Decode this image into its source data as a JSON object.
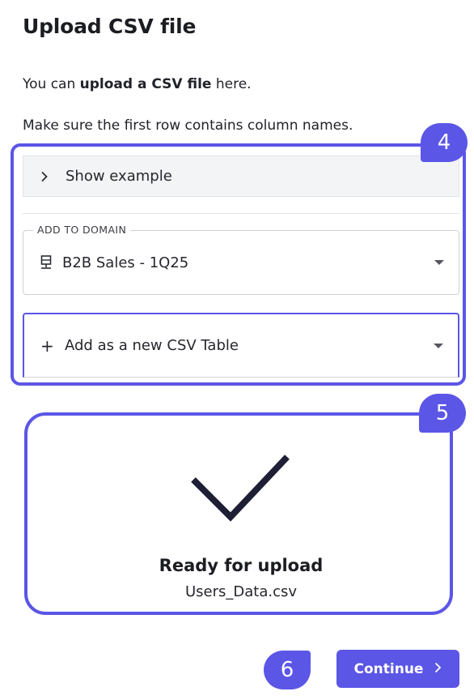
{
  "header": {
    "title": "Upload CSV file"
  },
  "intro": {
    "line1_prefix": "You can ",
    "line1_bold": "upload a CSV file",
    "line1_suffix": " here.",
    "line2": "Make sure the first row contains column names."
  },
  "example": {
    "label": "Show example",
    "icon": "chevron-right-icon"
  },
  "domain_select": {
    "legend": "ADD TO DOMAIN",
    "value": "B2B Sales - 1Q25",
    "icon": "server-icon"
  },
  "table_select": {
    "value": "Add as a new CSV Table",
    "icon": "plus-icon"
  },
  "upload_status": {
    "title": "Ready for upload",
    "filename": "Users_Data.csv",
    "icon": "checkmark-icon"
  },
  "actions": {
    "continue_label": "Continue"
  },
  "callouts": [
    "4",
    "5",
    "6"
  ],
  "colors": {
    "accent": "#5b56e6",
    "text": "#1f2024",
    "panel": "#f3f4f6"
  }
}
